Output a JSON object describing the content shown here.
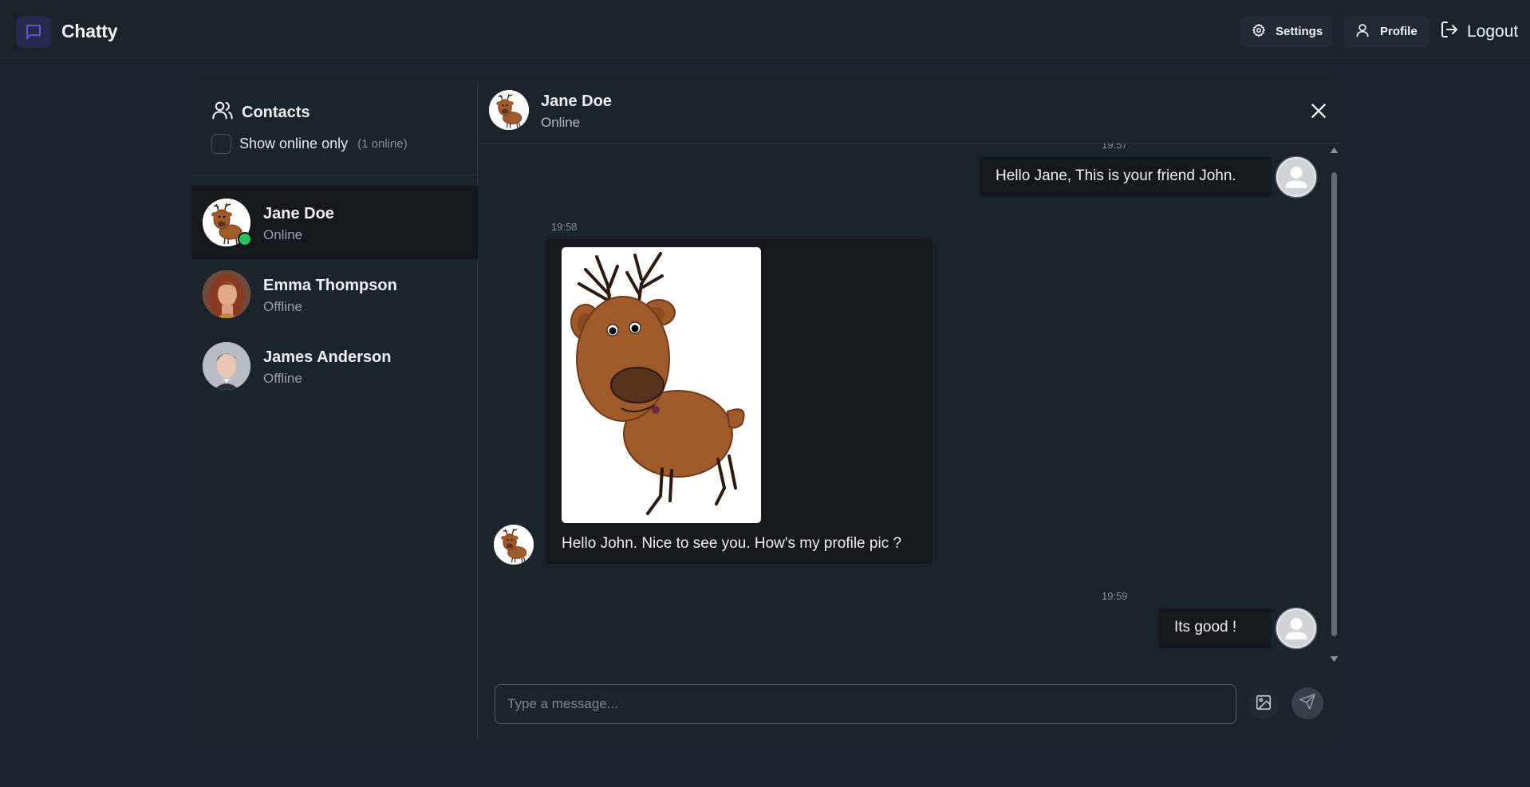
{
  "app": {
    "name": "Chatty"
  },
  "nav": {
    "settings_label": "Settings",
    "profile_label": "Profile",
    "logout_label": "Logout"
  },
  "sidebar": {
    "title": "Contacts",
    "filter_label": "Show online only",
    "online_count": "(1 online)",
    "contacts": [
      {
        "name": "Jane Doe",
        "status": "Online",
        "active": true
      },
      {
        "name": "Emma Thompson",
        "status": "Offline",
        "active": false
      },
      {
        "name": "James Anderson",
        "status": "Offline",
        "active": false
      }
    ]
  },
  "chat": {
    "name": "Jane Doe",
    "status": "Online",
    "messages": [
      {
        "time": "19:57",
        "text": "Hello Jane, This is your friend John.",
        "from": "me"
      },
      {
        "time": "19:58",
        "text": "Hello John. Nice to see you. How's my profile pic ?",
        "from": "Jane Doe",
        "has_image": true
      },
      {
        "time": "19:59",
        "text": "Its good !",
        "from": "me"
      }
    ],
    "input_placeholder": "Type a message..."
  },
  "colors": {
    "background": "#1c222b",
    "panel": "#1d232a",
    "bubble": "#15191e",
    "online": "#22c55e",
    "logo_accent": "#6b5cff"
  }
}
